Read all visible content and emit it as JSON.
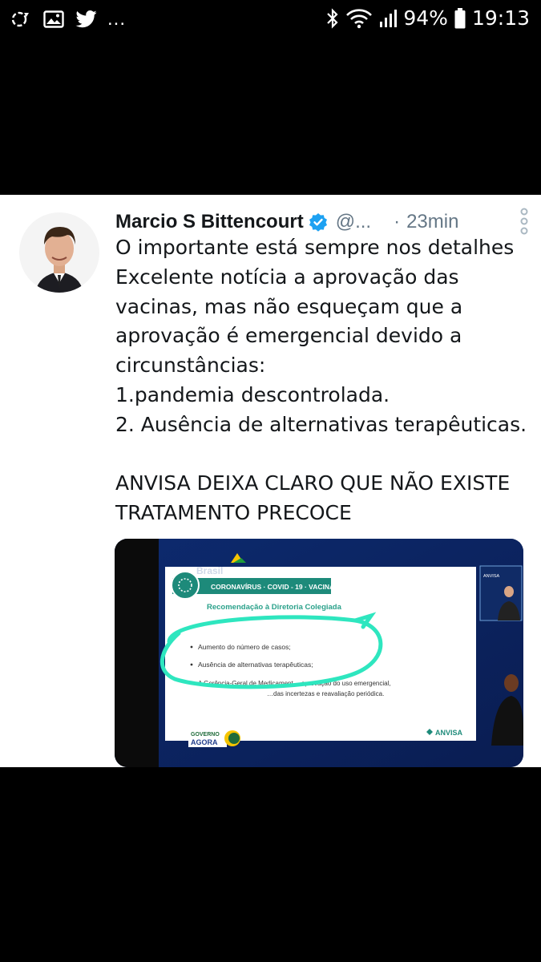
{
  "status_bar": {
    "battery": "94%",
    "time": "19:13",
    "left_icons": [
      "sync-icon",
      "gallery-icon",
      "twitter-icon"
    ],
    "overflow": "..."
  },
  "tweet": {
    "author": "Marcio S Bittencourt",
    "handle": "@...",
    "separator": "·",
    "time": "23min",
    "lines": [
      "O importante está sempre nos detalhes",
      "Excelente notícia a aprovação das",
      "vacinas, mas não esqueçam que a",
      "aprovação é emergencial devido a",
      "circunstâncias:",
      "1.pandemia descontrolada.",
      "2. Ausência de alternativas terapêuticas.",
      "",
      "ANVISA DEIXA CLARO QUE NÃO EXISTE",
      "TRATAMENTO PRECOCE"
    ]
  },
  "media": {
    "brand": "Brasil",
    "banner": "CORONAVÍRUS · COVID - 19 · VACINA",
    "subtitle": "Recomendação à Diretoria Colegiada",
    "bullets": [
      "Aumento do número de casos;",
      "Ausência de alternativas terapêuticas;"
    ],
    "tail_line1": "A Gerência-Geral de Medicament…  aprovação do uso emergencial,",
    "tail_line2": "…das incertezas e reavaliação periódica.",
    "gov_logo_line1": "GOVERNO",
    "gov_logo_line2": "AGORA",
    "anvisa_logo": "ANVISA",
    "inset_label": "ANVISA",
    "highlight_color": "#2ee6bf"
  }
}
